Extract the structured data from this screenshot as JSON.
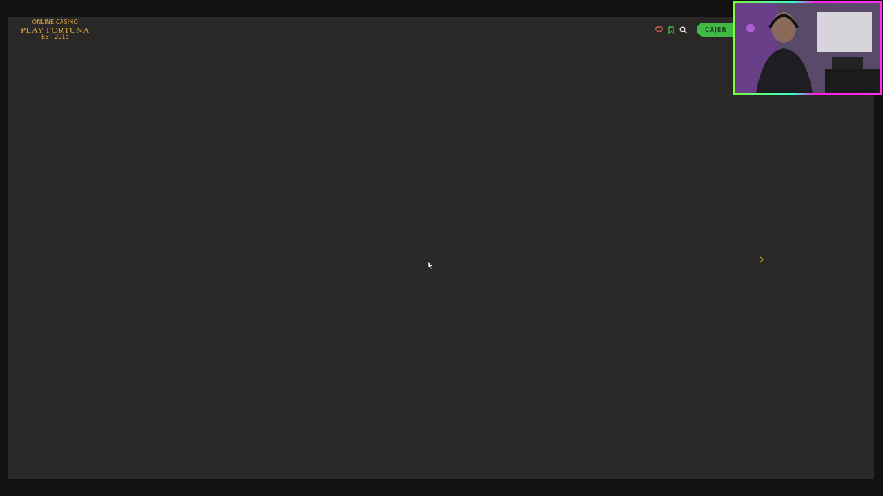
{
  "header": {
    "logo": {
      "tagline": "ONLINE CASINO",
      "name": "PLAY FORTUNA",
      "established": "EST. 2015"
    },
    "cashier_button": {
      "label": "CAJER"
    }
  }
}
